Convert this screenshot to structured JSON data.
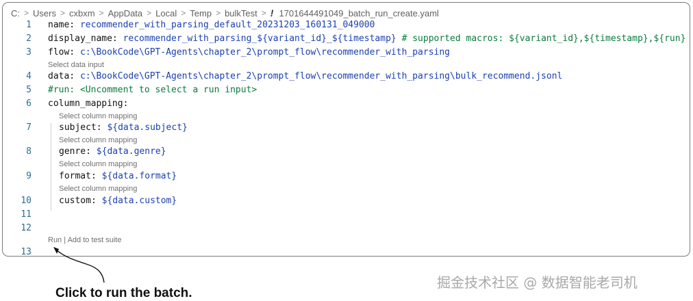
{
  "breadcrumb": {
    "segments": [
      "C:",
      "Users",
      "cxbxm",
      "AppData",
      "Local",
      "Temp",
      "bulkTest"
    ],
    "file_icon": "!",
    "file_name": "1701644491049_batch_run_create.yaml"
  },
  "editor": {
    "line_numbers": [
      "1",
      "2",
      "3",
      "4",
      "5",
      "6",
      "7",
      "8",
      "9",
      "10",
      "11",
      "12",
      "13"
    ],
    "lines": {
      "l1_key": "name: ",
      "l1_val": "recommender_with_parsing_default_20231203_160131_049000",
      "l2_key": "display_name: ",
      "l2_val": "recommender_with_parsing_${variant_id}_${timestamp}",
      "l2_comment": " # supported macros: ${variant_id},${timestamp},${run}",
      "l3_key": "flow: ",
      "l3_val": "c:\\BookCode\\GPT-Agents\\chapter_2\\prompt_flow\\recommender_with_parsing",
      "l4_key": "data: ",
      "l4_val": "c:\\BookCode\\GPT-Agents\\chapter_2\\prompt_flow\\recommender_with_parsing\\bulk_recommend.jsonl",
      "l5_comment": "#run: <Uncomment to select a run input>",
      "l6_key": "column_mapping:",
      "l7_key": "subject: ",
      "l7_val": "${data.subject}",
      "l8_key": "genre: ",
      "l8_val": "${data.genre}",
      "l9_key": "format: ",
      "l9_val": "${data.format}",
      "l10_key": "custom: ",
      "l10_val": "${data.custom}"
    },
    "codelens": {
      "select_data_input": "Select data input",
      "select_column_mapping": "Select column mapping",
      "run": "Run",
      "divider": " | ",
      "add_to_test_suite": "Add to test suite"
    }
  },
  "annotation": {
    "text": "Click to run the batch."
  },
  "watermark": {
    "text": "掘金技术社区 @ 数据智能老司机"
  }
}
